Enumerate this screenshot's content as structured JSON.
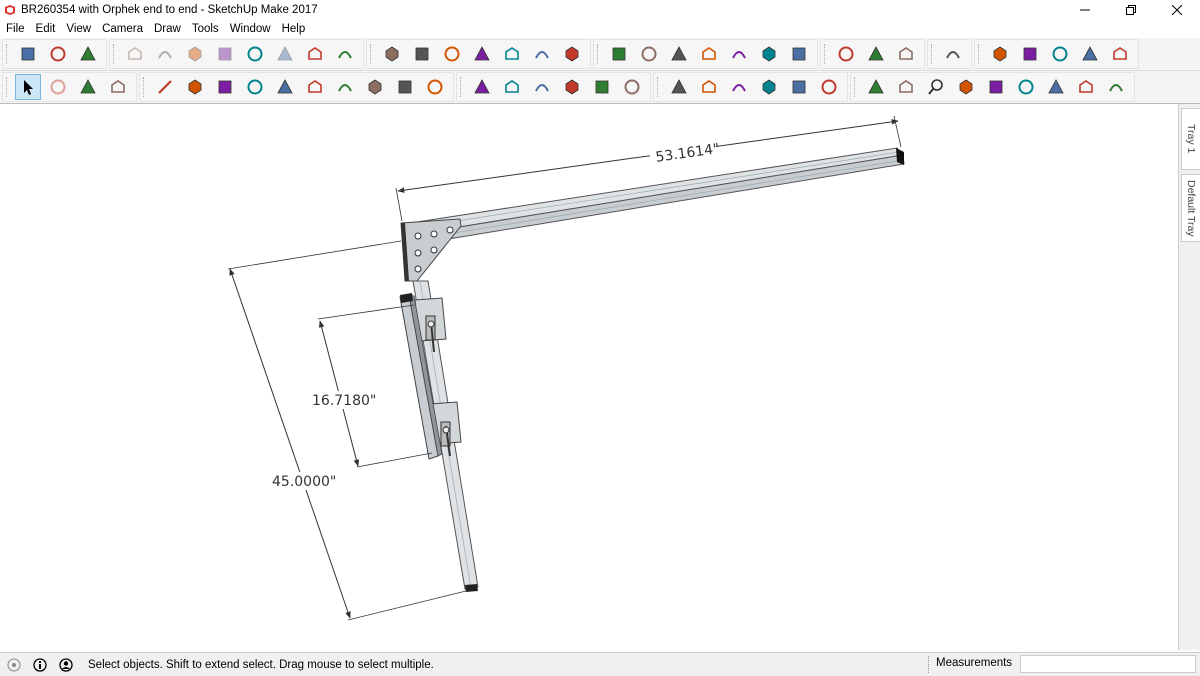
{
  "window": {
    "title": "BR260354 with Orphek end to end - SketchUp Make 2017",
    "controls": [
      "minimize-icon",
      "restore-icon",
      "close-icon"
    ]
  },
  "menu": [
    "File",
    "Edit",
    "View",
    "Camera",
    "Draw",
    "Tools",
    "Window",
    "Help"
  ],
  "toolbar_row1": [
    [
      "new-model-icon",
      "open-icon",
      "save-icon"
    ],
    [
      "cut-icon",
      "copy-icon",
      "paste-icon",
      "erase-selection-icon",
      "undo-icon",
      "redo-icon",
      "print-icon",
      "model-info-icon"
    ],
    [
      "iso-view-icon",
      "top-view-icon",
      "front-view-icon",
      "right-view-icon",
      "back-view-icon",
      "left-view-icon",
      "bottom-view-icon"
    ],
    [
      "xray-icon",
      "back-edges-icon",
      "wireframe-icon",
      "hidden-line-icon",
      "shaded-icon",
      "shaded-textures-icon",
      "monochrome-icon"
    ],
    [
      "section-plane-icon",
      "display-section-planes-icon",
      "display-section-cuts-icon"
    ],
    [
      "outer-shell-icon"
    ],
    [
      "intersect-icon",
      "union-icon",
      "subtract-icon",
      "trim-icon",
      "split-icon"
    ]
  ],
  "toolbar_row2": [
    [
      "select-icon",
      "make-component-icon",
      "paint-bucket-icon",
      "eraser-icon"
    ],
    [
      "line-icon",
      "freehand-icon",
      "rectangle-icon",
      "rotated-rectangle-icon",
      "circle-icon",
      "polygon-icon",
      "arc-icon",
      "two-point-arc-icon",
      "three-point-arc-icon",
      "pie-icon"
    ],
    [
      "move-icon",
      "push-pull-icon",
      "rotate-icon",
      "follow-me-icon",
      "scale-icon",
      "offset-icon"
    ],
    [
      "tape-measure-icon",
      "dimension-icon",
      "protractor-icon",
      "text-icon",
      "axes-icon",
      "3d-text-icon"
    ],
    [
      "orbit-icon",
      "pan-icon",
      "zoom-icon",
      "zoom-window-icon",
      "zoom-extents-icon",
      "previous-view-icon",
      "position-camera-icon",
      "look-around-icon",
      "walk-icon"
    ]
  ],
  "active_tools": [
    "section-plane-display-cuts",
    "select-icon"
  ],
  "dimensions": {
    "top_length": "53.1614\"",
    "left_height": "45.0000\"",
    "inner_height": "16.7180\""
  },
  "tray": {
    "tab1": "Tray 1",
    "tab2": "Default Tray"
  },
  "status": {
    "message": "Select objects. Shift to extend select. Drag mouse to select multiple.",
    "measurements_label": "Measurements",
    "measurements_value": ""
  },
  "colors": {
    "toolbar_bg": "#f4f4f4",
    "active_tool": "#cde6f7",
    "model_steel": "#d9dde0",
    "model_edge": "#555555"
  }
}
